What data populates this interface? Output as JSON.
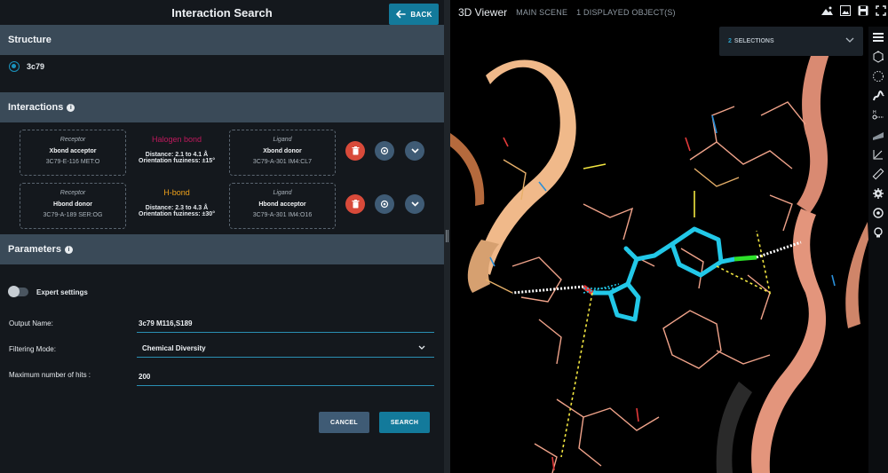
{
  "left": {
    "title": "Interaction Search",
    "back_label": "BACK",
    "structure": {
      "header": "Structure",
      "option": "3c79"
    },
    "interactions": {
      "header": "Interactions",
      "rows": [
        {
          "receptor_role": "Receptor",
          "receptor_kind": "Xbond acceptor",
          "receptor_res": "3C79-E-116 MET:O",
          "type": "Halogen bond",
          "type_color": "#c0195d",
          "distance": "Distance: 2.1 to 4.1 Å",
          "fuzziness": "Orientation fuziness: ±15°",
          "ligand_role": "Ligand",
          "ligand_kind": "Xbond donor",
          "ligand_res": "3C79-A-301 IM4:CL7"
        },
        {
          "receptor_role": "Receptor",
          "receptor_kind": "Hbond donor",
          "receptor_res": "3C79-A-189 SER:OG",
          "type": "H-bond",
          "type_color": "#f0a21a",
          "distance": "Distance: 2.3 to 4.3 Å",
          "fuzziness": "Orientation fuziness: ±30°",
          "ligand_role": "Ligand",
          "ligand_kind": "Hbond acceptor",
          "ligand_res": "3C79-A-301 IM4:O16"
        }
      ]
    },
    "parameters": {
      "header": "Parameters",
      "expert_label": "Expert settings",
      "output_name_label": "Output Name:",
      "output_name_value": "3c79 M116,S189",
      "filtering_label": "Filtering Mode:",
      "filtering_value": "Chemical Diversity",
      "max_hits_label": "Maximum number of hits :",
      "max_hits_value": "200",
      "cancel_label": "CANCEL",
      "search_label": "SEARCH"
    }
  },
  "viewer": {
    "title": "3D Viewer",
    "scene": "MAIN SCENE",
    "objects": "1 DISPLAYED OBJECT(S)",
    "selections_count": "2",
    "selections_label": "SELECTIONS",
    "header_icons": [
      "landscape-icon",
      "image-icon",
      "save-icon",
      "fullscreen-icon"
    ],
    "toolbar_icons": [
      "menu-icon",
      "molecule-icon",
      "surface-icon",
      "ribbon-icon",
      "hbond-icon",
      "grid-icon",
      "measure-icon",
      "ruler-icon",
      "settings-icon",
      "target-icon",
      "bulb-icon"
    ]
  },
  "colors": {
    "accent": "#137a9b",
    "section_bg": "#3a4a58",
    "danger": "#d84a3a",
    "panel_bg": "#14181d"
  }
}
